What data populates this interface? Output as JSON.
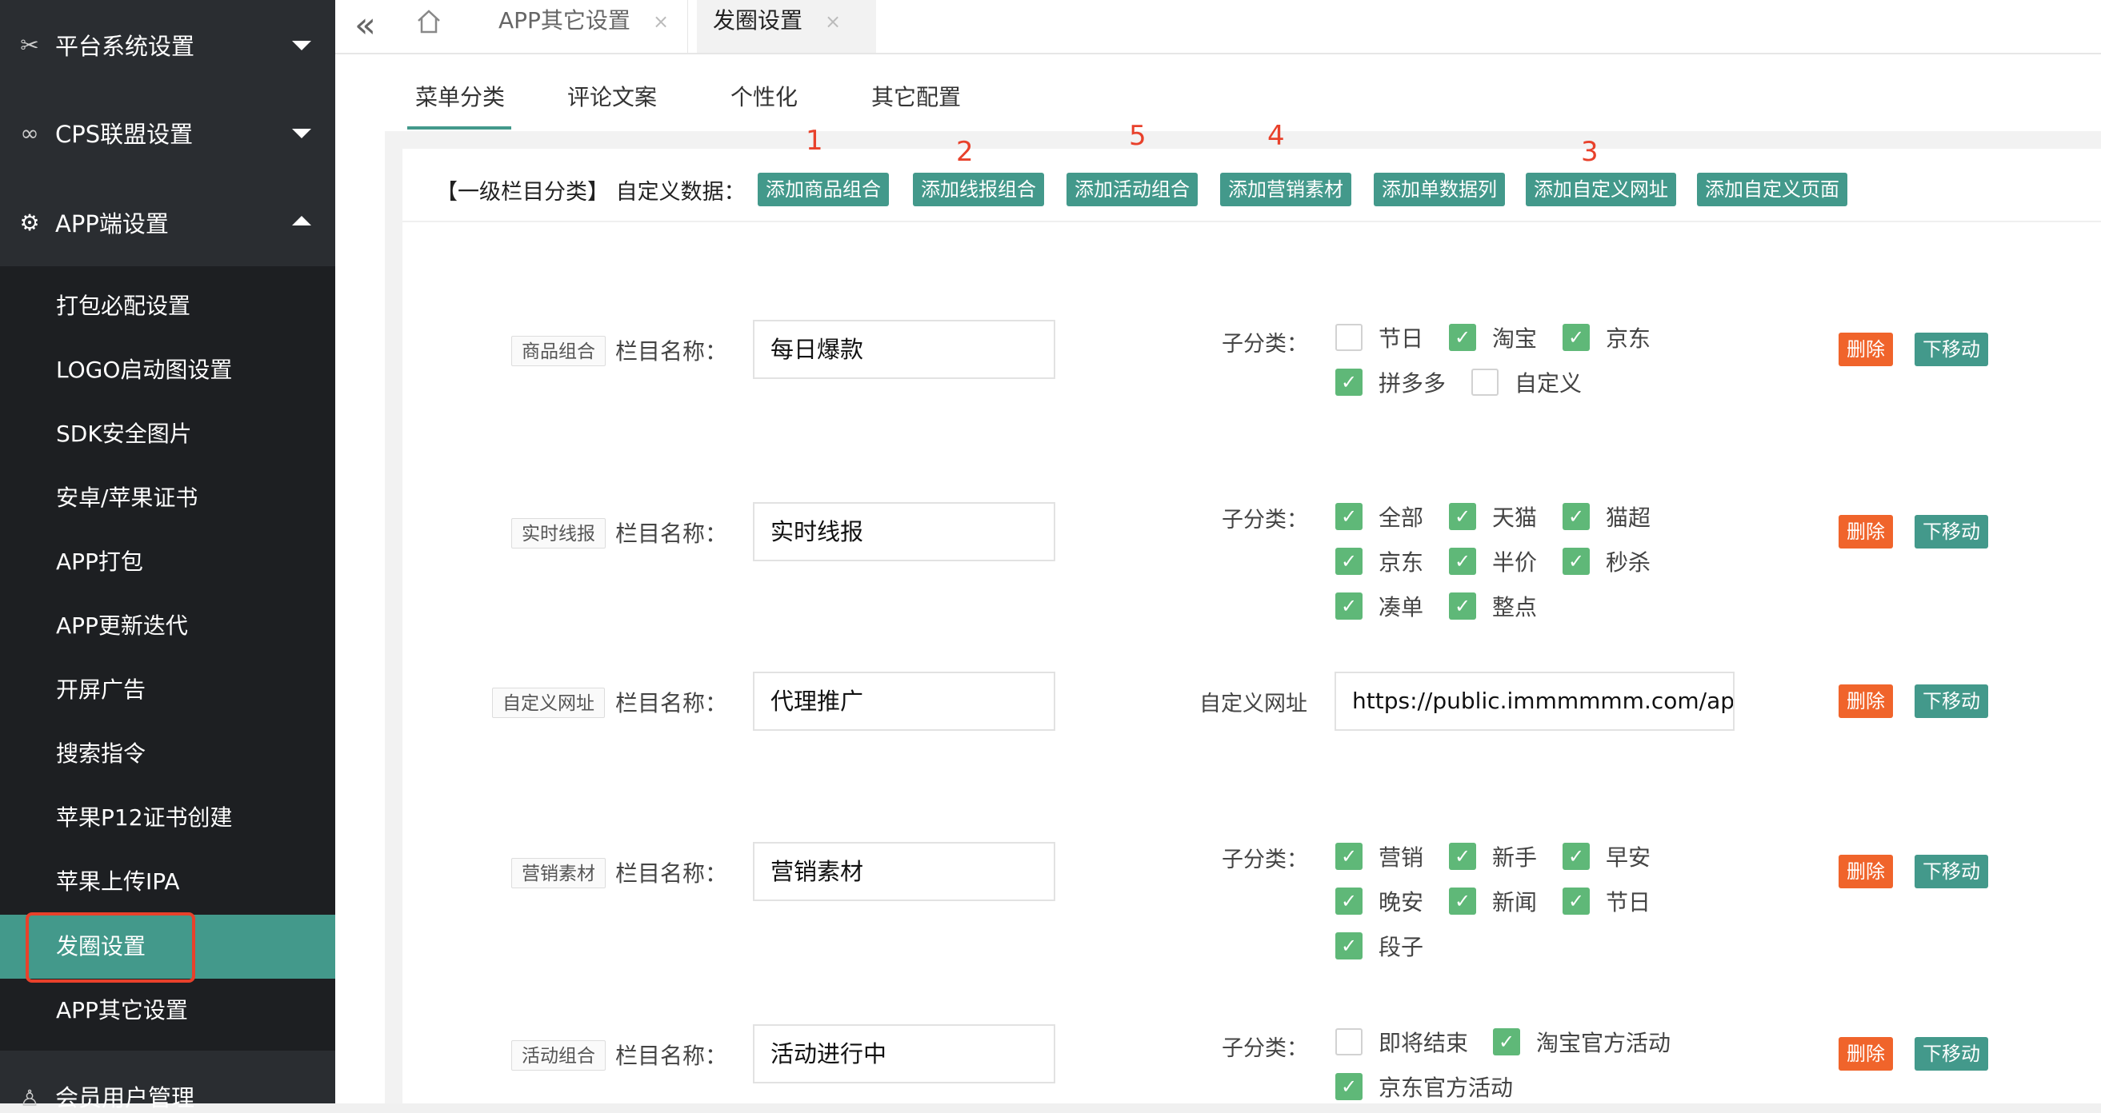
{
  "sidebar": {
    "groups": [
      {
        "label": "平台系统设置",
        "icon": "tools-icon"
      },
      {
        "label": "CPS联盟设置",
        "icon": "link-icon"
      },
      {
        "label": "APP端设置",
        "icon": "gear-icon"
      }
    ],
    "items": [
      "打包必配设置",
      "LOGO启动图设置",
      "SDK安全图片",
      "安卓/苹果证书",
      "APP打包",
      "APP更新迭代",
      "开屏广告",
      "搜索指令",
      "苹果P12证书创建",
      "苹果上传IPA",
      "发圈设置",
      "APP其它设置"
    ],
    "bottom_group": "会员用户管理"
  },
  "topbar": {
    "tabs": [
      "APP其它设置",
      "发圈设置"
    ],
    "close": "×"
  },
  "content_tabs": [
    "菜单分类",
    "评论文案",
    "个性化",
    "其它配置"
  ],
  "toolbar": {
    "label": "【一级栏目分类】 自定义数据：",
    "buttons": [
      "添加商品组合",
      "添加线报组合",
      "添加活动组合",
      "添加营销素材",
      "添加单数据列",
      "添加自定义网址",
      "添加自定义页面"
    ],
    "annotations": [
      "1",
      "2",
      "5",
      "4",
      "3"
    ]
  },
  "rows": [
    {
      "tag": "商品组合",
      "name_label": "栏目名称：",
      "value": "每日爆款",
      "sub_label": "子分类：",
      "options": [
        {
          "t": "节日",
          "on": false
        },
        {
          "t": "淘宝",
          "on": true
        },
        {
          "t": "京东",
          "on": true
        },
        {
          "t": "拼多多",
          "on": true
        },
        {
          "t": "自定义",
          "on": false
        }
      ]
    },
    {
      "tag": "实时线报",
      "name_label": "栏目名称：",
      "value": "实时线报",
      "sub_label": "子分类：",
      "options": [
        {
          "t": "全部",
          "on": true
        },
        {
          "t": "天猫",
          "on": true
        },
        {
          "t": "猫超",
          "on": true
        },
        {
          "t": "京东",
          "on": true
        },
        {
          "t": "半价",
          "on": true
        },
        {
          "t": "秒杀",
          "on": true
        },
        {
          "t": "凑单",
          "on": true
        },
        {
          "t": "整点",
          "on": true
        }
      ]
    },
    {
      "tag": "自定义网址",
      "name_label": "栏目名称：",
      "value": "代理推广",
      "sub_label": "自定义网址",
      "url": "https://public.immmmmm.com/app/pa"
    },
    {
      "tag": "营销素材",
      "name_label": "栏目名称：",
      "value": "营销素材",
      "sub_label": "子分类：",
      "options": [
        {
          "t": "营销",
          "on": true
        },
        {
          "t": "新手",
          "on": true
        },
        {
          "t": "早安",
          "on": true
        },
        {
          "t": "晚安",
          "on": true
        },
        {
          "t": "新闻",
          "on": true
        },
        {
          "t": "节日",
          "on": true
        },
        {
          "t": "段子",
          "on": true
        }
      ]
    },
    {
      "tag": "活动组合",
      "name_label": "栏目名称：",
      "value": "活动进行中",
      "sub_label": "子分类：",
      "options": [
        {
          "t": "即将结束",
          "on": false
        },
        {
          "t": "淘宝官方活动",
          "on": true
        },
        {
          "t": "京东官方活动",
          "on": true
        }
      ]
    }
  ],
  "actions": {
    "delete": "删除",
    "move_down": "下移动"
  },
  "colors": {
    "sidebar": "#2a2d31",
    "submenu": "#1d1f22",
    "accent": "#43998b",
    "delete": "#f0642b",
    "checked": "#5fb878",
    "annotation": "#e8412b"
  }
}
